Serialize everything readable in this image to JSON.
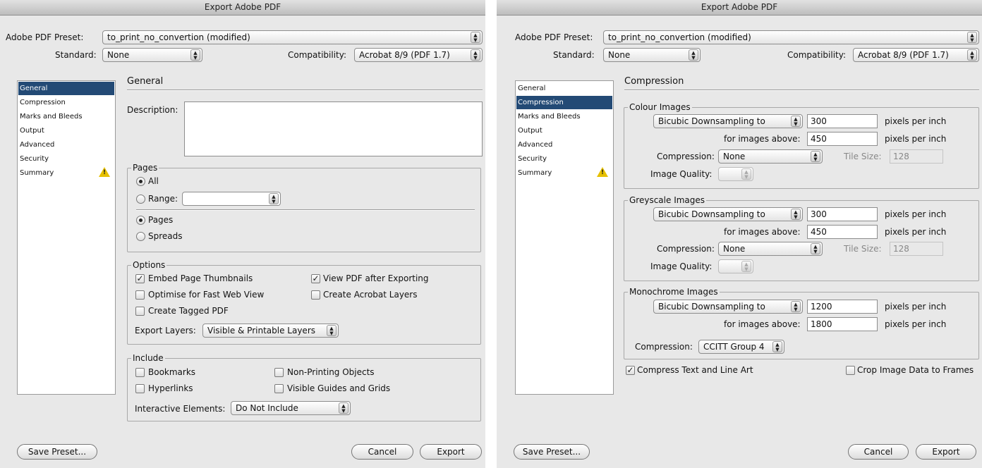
{
  "window": {
    "title": "Export Adobe PDF"
  },
  "header": {
    "preset_label": "Adobe PDF Preset:",
    "preset_value": "to_print_no_convertion (modified)",
    "standard_label": "Standard:",
    "standard_value": "None",
    "compat_label": "Compatibility:",
    "compat_value": "Acrobat 8/9 (PDF 1.7)"
  },
  "sidebar": {
    "items": [
      {
        "label": "General"
      },
      {
        "label": "Compression"
      },
      {
        "label": "Marks and Bleeds"
      },
      {
        "label": "Output"
      },
      {
        "label": "Advanced"
      },
      {
        "label": "Security"
      },
      {
        "label": "Summary"
      }
    ],
    "warning_glyph": "!"
  },
  "general": {
    "title": "General",
    "description_label": "Description:",
    "description_value": "",
    "pages": {
      "legend": "Pages",
      "all": "All",
      "range": "Range:",
      "range_value": "",
      "pages": "Pages",
      "spreads": "Spreads"
    },
    "options": {
      "legend": "Options",
      "embed_thumbs": "Embed Page Thumbnails",
      "view_pdf": "View PDF after Exporting",
      "optimise": "Optimise for Fast Web View",
      "acrobat_layers": "Create Acrobat Layers",
      "tagged_pdf": "Create Tagged PDF",
      "export_layers_label": "Export Layers:",
      "export_layers_value": "Visible & Printable Layers"
    },
    "include": {
      "legend": "Include",
      "bookmarks": "Bookmarks",
      "non_printing": "Non-Printing Objects",
      "hyperlinks": "Hyperlinks",
      "guides": "Visible Guides and Grids",
      "interactive_label": "Interactive Elements:",
      "interactive_value": "Do Not Include"
    }
  },
  "compression": {
    "title": "Compression",
    "colour": {
      "legend": "Colour Images",
      "method": "Bicubic Downsampling to",
      "ppi": "300",
      "ppi_unit": "pixels per inch",
      "above_label": "for images above:",
      "above": "450",
      "above_unit": "pixels per inch",
      "comp_label": "Compression:",
      "comp_value": "None",
      "tile_label": "Tile Size:",
      "tile_value": "128",
      "quality_label": "Image Quality:"
    },
    "grey": {
      "legend": "Greyscale Images",
      "method": "Bicubic Downsampling to",
      "ppi": "300",
      "ppi_unit": "pixels per inch",
      "above_label": "for images above:",
      "above": "450",
      "above_unit": "pixels per inch",
      "comp_label": "Compression:",
      "comp_value": "None",
      "tile_label": "Tile Size:",
      "tile_value": "128",
      "quality_label": "Image Quality:"
    },
    "mono": {
      "legend": "Monochrome Images",
      "method": "Bicubic Downsampling to",
      "ppi": "1200",
      "ppi_unit": "pixels per inch",
      "above_label": "for images above:",
      "above": "1800",
      "above_unit": "pixels per inch",
      "comp_label": "Compression:",
      "comp_value": "CCITT Group 4"
    },
    "compress_text": "Compress Text and Line Art",
    "crop_image": "Crop Image Data to Frames"
  },
  "buttons": {
    "save_preset": "Save Preset...",
    "cancel": "Cancel",
    "export": "Export"
  },
  "glyphs": {
    "check": "✓",
    "arrows": "▲▼"
  },
  "colors": {
    "selection": "#234a75",
    "warning": "#e6c000"
  }
}
